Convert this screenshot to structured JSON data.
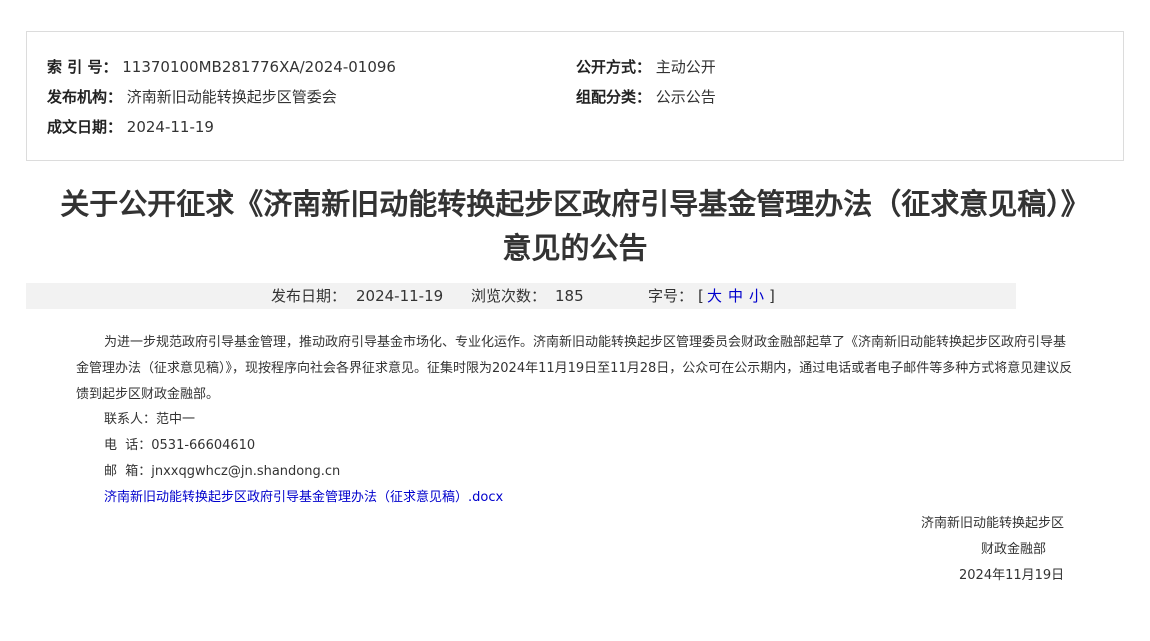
{
  "meta": {
    "index_label": "索 引 号：",
    "index_value": "11370100MB281776XA/2024-01096",
    "publish_method_label": "公开方式：",
    "publish_method_value": "主动公开",
    "issuer_label": "发布机构：",
    "issuer_value": "济南新旧动能转换起步区管委会",
    "category_label": "组配分类：",
    "category_value": "公示公告",
    "date_label": "成文日期：",
    "date_value": "2024-11-19"
  },
  "title": "关于公开征求《济南新旧动能转换起步区政府引导基金管理办法（征求意见稿）》意见的公告",
  "info_bar": {
    "publish_date_label": "发布日期：",
    "publish_date_value": "2024-11-19",
    "views_label": "浏览次数：",
    "views_value": "185",
    "font_size_label": "字号：",
    "bracket_open": "[",
    "size_large": "大",
    "size_medium": "中",
    "size_small": "小",
    "bracket_close": "]"
  },
  "body": {
    "paragraph": "为进一步规范政府引导基金管理，推动政府引导基金市场化、专业化运作。济南新旧动能转换起步区管理委员会财政金融部起草了《济南新旧动能转换起步区政府引导基金管理办法（征求意见稿）》，现按程序向社会各界征求意见。征集时限为2024年11月19日至11月28日，公众可在公示期内，通过电话或者电子邮件等多种方式将意见建议反馈到起步区财政金融部。",
    "contact": "联系人：范中一",
    "phone": "电  话：0531-66604610",
    "email": "邮  箱：jnxxqgwhcz@jn.shandong.cn",
    "attachment": "济南新旧动能转换起步区政府引导基金管理办法（征求意见稿）.docx"
  },
  "signature": {
    "org_line1": "济南新旧动能转换起步区",
    "org_line2": "财政金融部",
    "date": "2024年11月19日"
  },
  "colors": {
    "link": "#0000cc",
    "bar_bg": "#f2f2f2",
    "border": "#dcdcdc"
  }
}
